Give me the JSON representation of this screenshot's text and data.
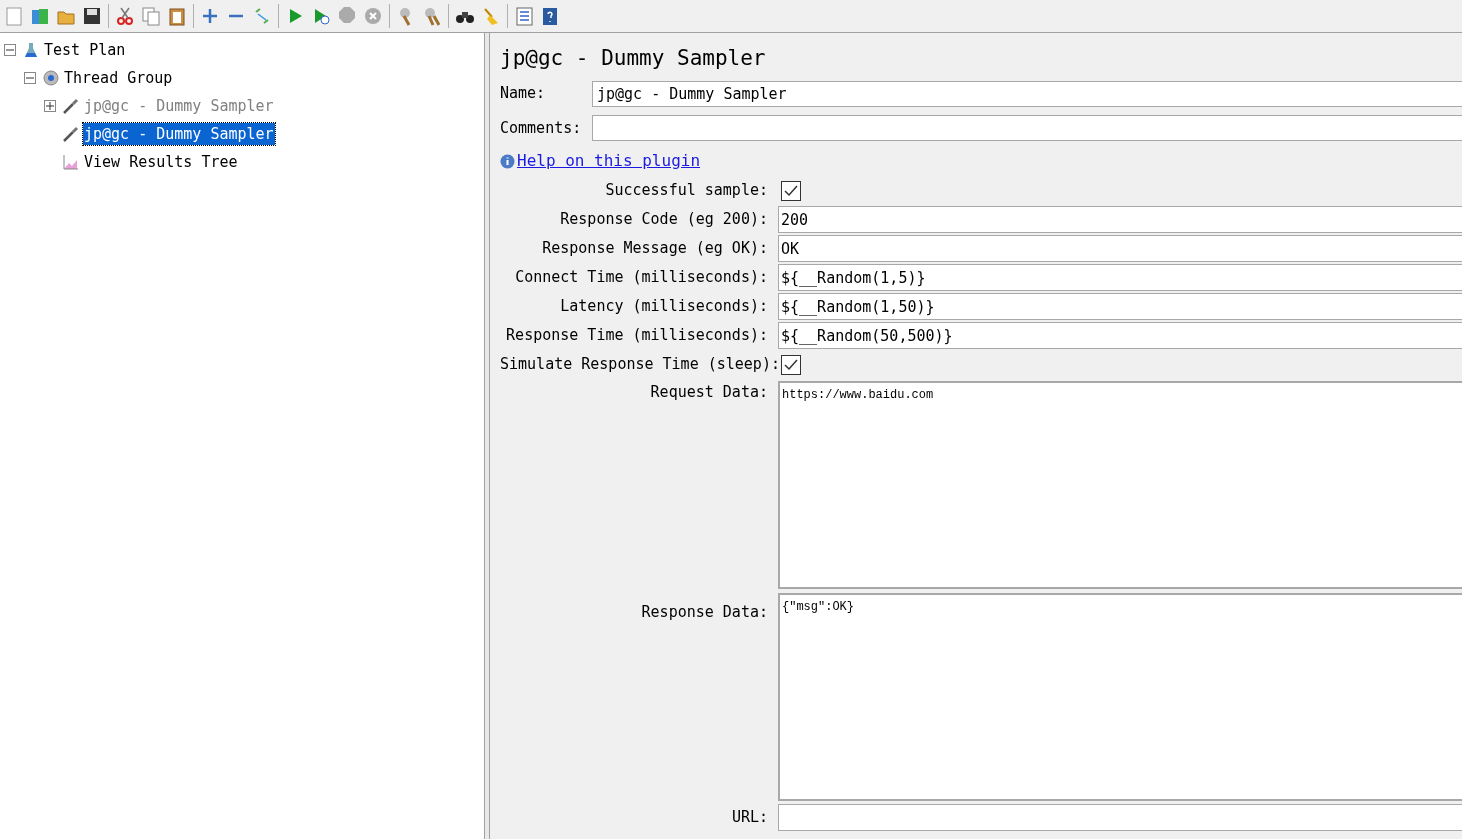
{
  "tree": [
    {
      "label": "Test Plan",
      "kind": "plan",
      "expanded": true,
      "selected": false,
      "disabled": false,
      "children": [
        {
          "label": "Thread Group",
          "kind": "group",
          "expanded": true,
          "selected": false,
          "disabled": false,
          "children": [
            {
              "label": "jp@gc - Dummy Sampler",
              "kind": "sampler",
              "expanded": false,
              "selected": false,
              "disabled": true
            },
            {
              "label": "jp@gc - Dummy Sampler",
              "kind": "sampler",
              "selected": true,
              "disabled": false
            },
            {
              "label": "View Results Tree",
              "kind": "listener",
              "selected": false,
              "disabled": false
            }
          ]
        }
      ]
    }
  ],
  "panel": {
    "title": "jp@gc - Dummy Sampler",
    "name_label": "Name:",
    "name_value": "jp@gc - Dummy Sampler",
    "comments_label": "Comments:",
    "help_link": "Help on this plugin",
    "fields": [
      {
        "kind": "checkbox",
        "label": "Successful sample:",
        "checked": true
      },
      {
        "kind": "text",
        "label": "Response Code (eg 200):",
        "value": "200"
      },
      {
        "kind": "text",
        "label": "Response Message (eg OK):",
        "value": "OK"
      },
      {
        "kind": "text",
        "label": "Connect Time (milliseconds):",
        "value": "${__Random(1,5)}"
      },
      {
        "kind": "text",
        "label": "Latency (milliseconds):",
        "value": "${__Random(1,50)}"
      },
      {
        "kind": "text",
        "label": "Response Time (milliseconds):",
        "value": "${__Random(50,500)}"
      },
      {
        "kind": "checkbox",
        "label": "Simulate Response Time (sleep):",
        "checked": true
      },
      {
        "kind": "textarea",
        "label": "Request Data:",
        "value": "https://www.baidu.com"
      },
      {
        "kind": "textarea",
        "label": "Response Data:",
        "value": "{\"msg\":OK}"
      },
      {
        "kind": "text",
        "label": "URL:"
      }
    ]
  }
}
